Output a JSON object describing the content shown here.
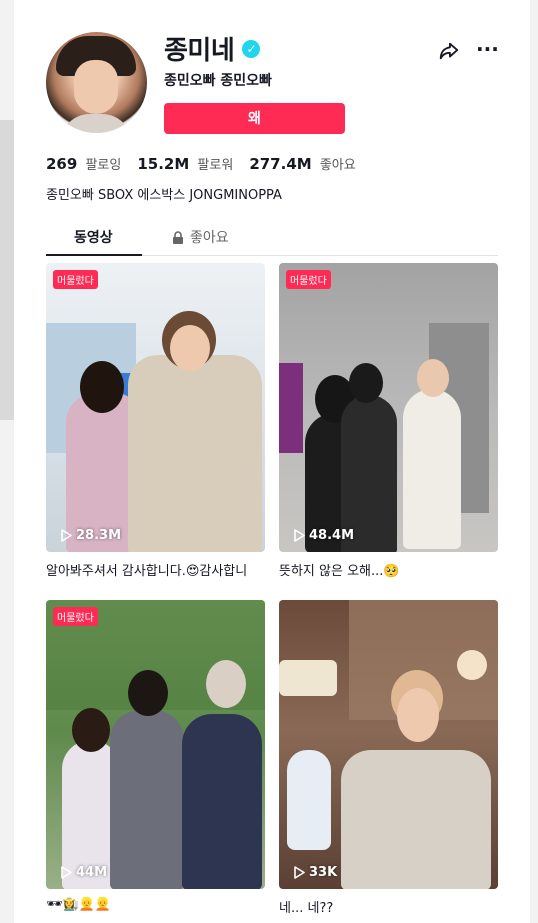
{
  "profile": {
    "username": "종미네",
    "nickname": "종민오빠 종민오빠",
    "follow_label": "왜",
    "bio": "종민오빠 SBOX 에스박스 JONGMINOPPA",
    "stats": [
      {
        "num": "269",
        "label": "팔로잉"
      },
      {
        "num": "15.2M",
        "label": "팔로워"
      },
      {
        "num": "277.4M",
        "label": "좋아요"
      }
    ]
  },
  "tabs": {
    "videos": "동영상",
    "likes": "좋아요"
  },
  "videos": [
    {
      "pinned": "머물렀다",
      "views": "28.3M",
      "caption": "알아봐주셔서 감사합니다.😍감사합니"
    },
    {
      "pinned": "머물렀다",
      "views": "48.4M",
      "caption": "뜻하지 않은 오해...🥺"
    },
    {
      "pinned": "머물렀다",
      "views": "44M",
      "caption": "🕶👩‍🌾👱👱"
    },
    {
      "pinned": "",
      "views": "33K",
      "caption": "네... 네??"
    }
  ],
  "colors": {
    "accent": "#fe2c55",
    "verified": "#20d5ec"
  }
}
